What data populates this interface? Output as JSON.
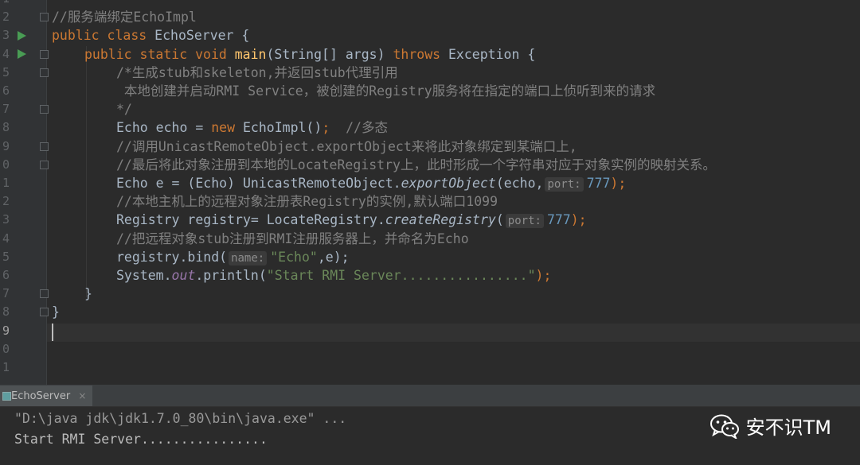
{
  "line_numbers": [
    "2",
    "3",
    "4",
    "5",
    "6",
    "7",
    "8",
    "9",
    "0",
    "1",
    "2",
    "3",
    "4",
    "5",
    "6",
    "7",
    "8",
    "9",
    "0",
    "1"
  ],
  "top_partial_line_number": "1",
  "code": {
    "l1": "//服务端绑定EchoImpl",
    "l2_kw": "public class",
    "l2_name": " EchoServer {",
    "l3_kw1": "public static void",
    "l3_fn": "main",
    "l3_args": "(String[] args) ",
    "l3_kw2": "throws",
    "l3_rest": " Exception {",
    "l4": "/*生成stub和skeleton,并返回stub代理引用",
    "l5": " 本地创建并启动RMI Service，被创建的Registry服务将在指定的端口上侦听到来的请求",
    "l6": "*/",
    "l7_a": "Echo echo = ",
    "l7_kw": "new",
    "l7_b": " EchoImpl()",
    "l7_semi": ";",
    "l7_cm": "  //多态",
    "l8": "//调用UnicastRemoteObject.exportObject来将此对象绑定到某端口上,",
    "l9": "//最后将此对象注册到本地的LocateRegistry上，此时形成一个字符串对应于对象实例的映射关系。",
    "l10_a": "Echo e = (Echo) UnicastRemoteObject.",
    "l10_it": "exportObject",
    "l10_b": "(echo,",
    "l10_hint": "port:",
    "l10_num": "777",
    "l10_c": ");",
    "l11": "//本地主机上的远程对象注册表Registry的实例,默认端口1099",
    "l12_a": "Registry registry= LocateRegistry.",
    "l12_it": "createRegistry",
    "l12_b": "(",
    "l12_hint": "port:",
    "l12_num": "777",
    "l12_c": ");",
    "l13": "//把远程对象stub注册到RMI注册服务器上，并命名为Echo",
    "l14_a": "registry.bind(",
    "l14_hint": "name:",
    "l14_str": "\"Echo\"",
    "l14_b": ",e);",
    "l15_a": "System.",
    "l15_stat": "out",
    "l15_b": ".println(",
    "l15_str": "\"Start RMI Server................\"",
    "l15_c": ");",
    "l16": "}",
    "l17": "}"
  },
  "run_panel": {
    "tab_label": "EchoServer",
    "close_glyph": "×",
    "command_line": "\"D:\\java jdk\\jdk1.7.0_80\\bin\\java.exe\" ...",
    "output_line": "Start RMI Server................"
  },
  "watermark": {
    "text": "安不识TM",
    "icon": "wechat-icon"
  }
}
